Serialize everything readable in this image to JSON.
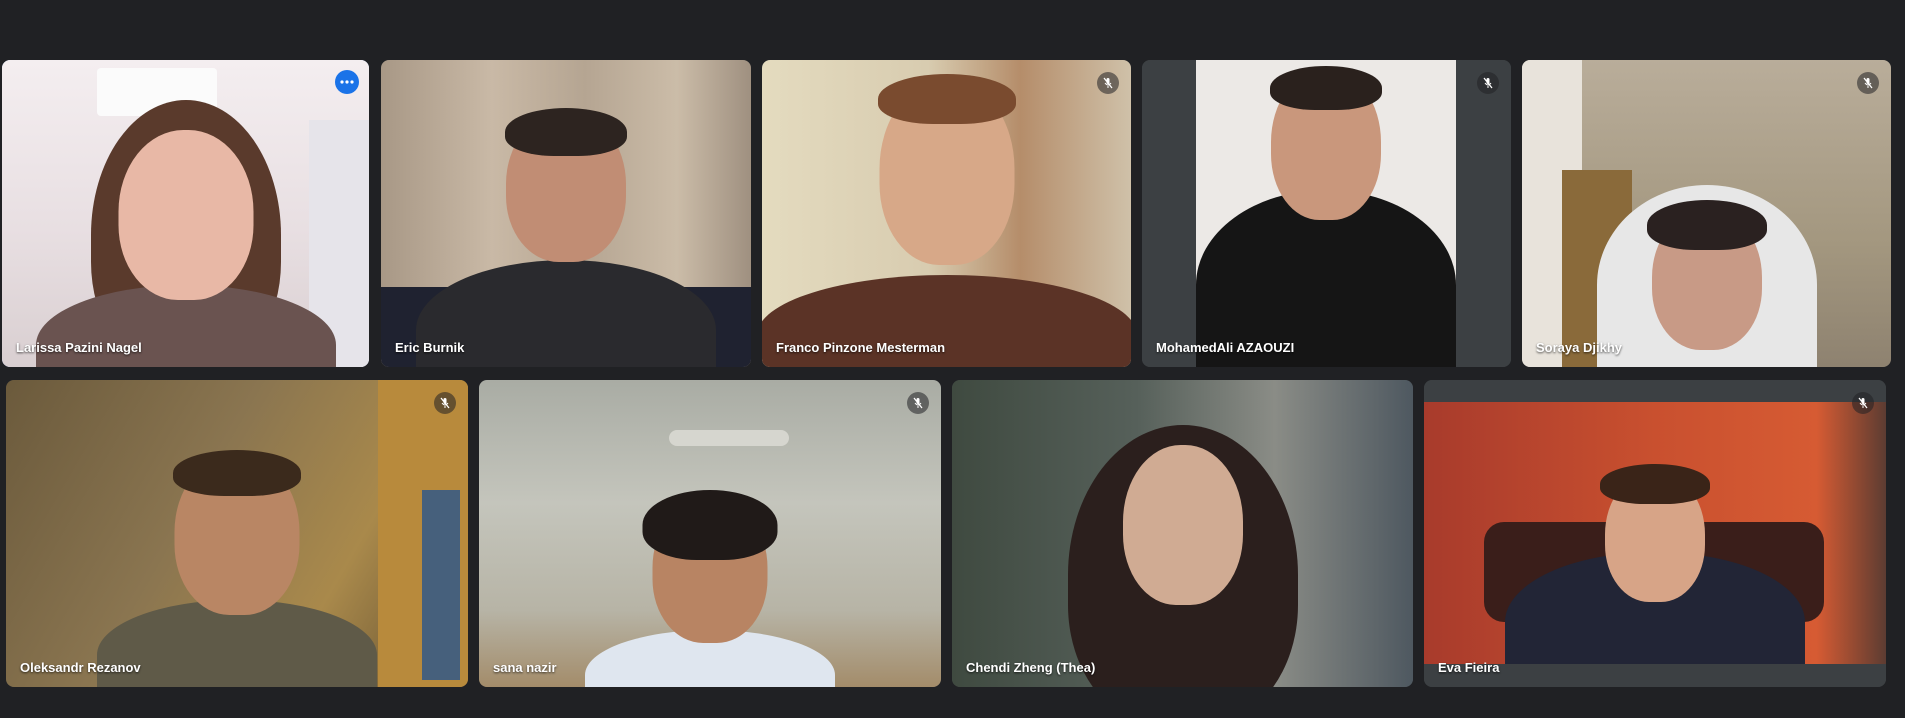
{
  "participants": [
    {
      "name": "Larissa Pazini Nagel",
      "muted": false,
      "active": true,
      "icon": "more-options-icon"
    },
    {
      "name": "Eric Burnik",
      "muted": false,
      "active": false
    },
    {
      "name": "Franco Pinzone Mesterman",
      "muted": true,
      "active": false
    },
    {
      "name": "MohamedAli AZAOUZI",
      "muted": true,
      "active": false
    },
    {
      "name": "Soraya Djikhy",
      "muted": true,
      "active": false
    },
    {
      "name": "Oleksandr Rezanov",
      "muted": true,
      "active": false
    },
    {
      "name": "sana nazir",
      "muted": true,
      "active": false
    },
    {
      "name": "Chendi Zheng (Thea)",
      "muted": false,
      "active": false
    },
    {
      "name": "Eva Fieira",
      "muted": true,
      "active": false
    }
  ],
  "colors": {
    "background": "#202124",
    "active_outline": "#8ab4f8",
    "more_button": "#1a73e8"
  }
}
